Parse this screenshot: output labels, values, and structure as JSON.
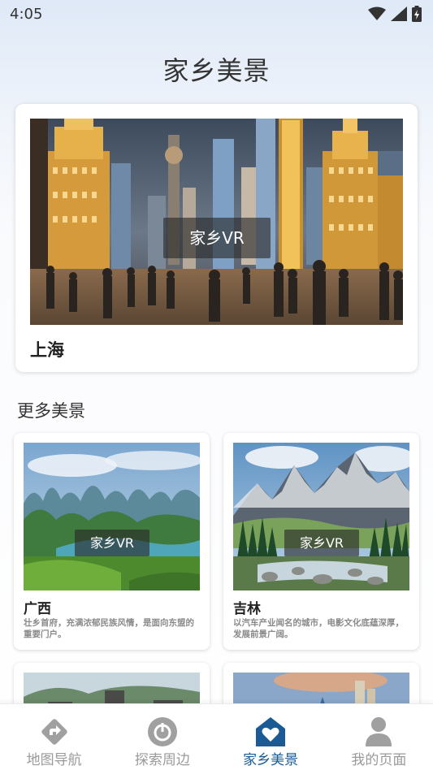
{
  "status_bar": {
    "time": "4:05"
  },
  "header": {
    "title": "家乡美景"
  },
  "featured": {
    "name": "上海",
    "vr_label": "家乡VR"
  },
  "more_section": {
    "title": "更多美景",
    "cards": [
      {
        "name": "广西",
        "desc": "壮乡首府，充满浓郁民族风情，是面向东盟的重要门户。",
        "vr_label": "家乡VR"
      },
      {
        "name": "吉林",
        "desc": "以汽车产业闻名的城市，电影文化底蕴深厚，发展前景广阔。",
        "vr_label": "家乡VR"
      }
    ]
  },
  "bottom_nav": {
    "items": [
      {
        "label": "地图导航",
        "icon": "navigation-icon"
      },
      {
        "label": "探索周边",
        "icon": "compass-icon"
      },
      {
        "label": "家乡美景",
        "icon": "home-heart-icon"
      },
      {
        "label": "我的页面",
        "icon": "user-icon"
      }
    ],
    "active_color": "#1a5b95",
    "inactive_color": "#9a9a9a"
  }
}
